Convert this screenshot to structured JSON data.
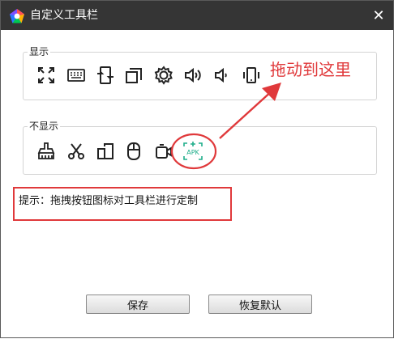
{
  "window": {
    "title": "自定义工具栏",
    "close_glyph": "✕"
  },
  "shown_group": {
    "label": "显示",
    "icons": [
      "fullscreen-icon",
      "keyboard-icon",
      "screen-rotate-icon",
      "window-copy-icon",
      "settings-gear-icon",
      "volume-up-icon",
      "volume-down-icon",
      "vibrate-phone-icon"
    ]
  },
  "hidden_group": {
    "label": "不显示",
    "icons": [
      "clean-brush-icon",
      "scissors-icon",
      "multi-device-icon",
      "mouse-icon",
      "camera-record-icon",
      "install-apk-icon"
    ],
    "apk_text": "APK"
  },
  "annotation": {
    "drag_hint": "拖动到这里",
    "color": "#e0393b"
  },
  "hint": "提示：拖拽按钮图标对工具栏进行定制",
  "buttons": {
    "save": "保存",
    "restore": "恢复默认"
  },
  "colors": {
    "titlebar": "#353535",
    "accent_green": "#1fae8a"
  }
}
